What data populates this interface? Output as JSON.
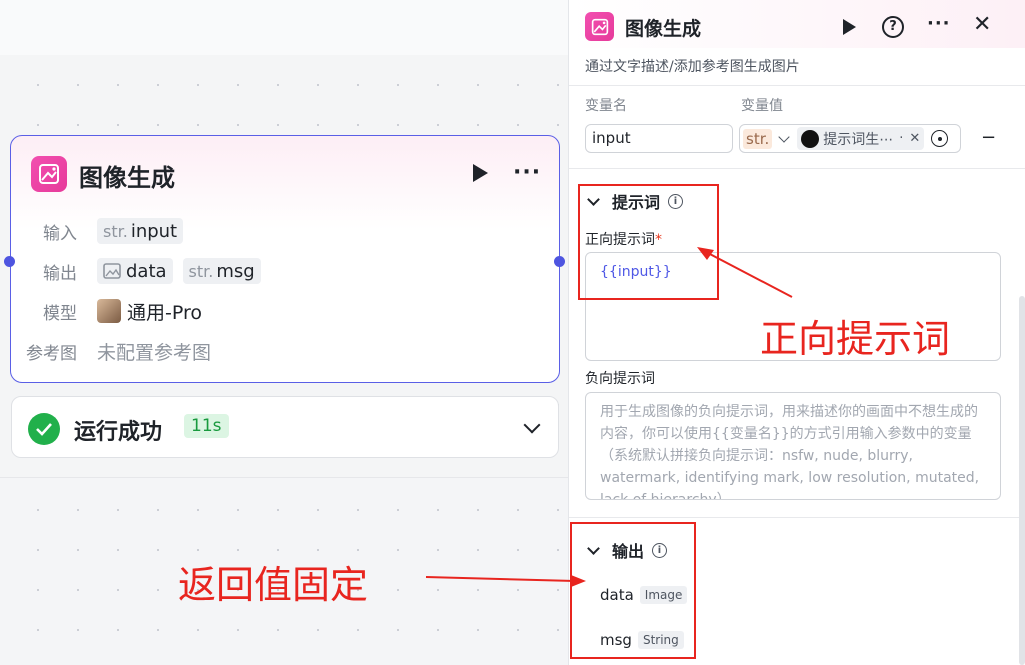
{
  "node": {
    "title": "图像生成",
    "rows": {
      "input_label": "输入",
      "input_tag_prefix": "str.",
      "input_tag_value": "input",
      "output_label": "输出",
      "output_tag1": "data",
      "output_tag2_prefix": "str.",
      "output_tag2_value": "msg",
      "model_label": "模型",
      "model_value": "通用-Pro",
      "ref_label": "参考图",
      "ref_value": "未配置参考图"
    }
  },
  "run_status": {
    "text": "运行成功",
    "time": "11s"
  },
  "panel": {
    "title": "图像生成",
    "description": "通过文字描述/添加参考图生成图片",
    "var_name_header": "变量名",
    "var_value_header": "变量值",
    "var_name_value": "input",
    "var_type": "str.",
    "var_ref_text": "提示词生⋯",
    "var_ref_dot": "·",
    "remove_symbol": "−",
    "prompt_section": "提示词",
    "positive_label": "正向提示词",
    "required_mark": "*",
    "positive_value": "{{input}}",
    "negative_label": "负向提示词",
    "negative_placeholder": "用于生成图像的负向提示词，用来描述你的画面中不想生成的内容，你可以使用{{变量名}}的方式引用输入参数中的变量（系统默认拼接负向提示词：nsfw, nude, blurry, watermark, identifying mark, low resolution, mutated, lack of hierarchy）",
    "output_section": "输出",
    "outputs": [
      {
        "name": "data",
        "type": "Image"
      },
      {
        "name": "msg",
        "type": "String"
      }
    ]
  },
  "annotations": {
    "positive_prompt": "正向提示词",
    "fixed_return": "返回值固定"
  },
  "colors": {
    "accent": "#5a5fe6",
    "brand_pink": "#e63a9a",
    "success": "#21b04b",
    "annotation_red": "#e8251f"
  }
}
